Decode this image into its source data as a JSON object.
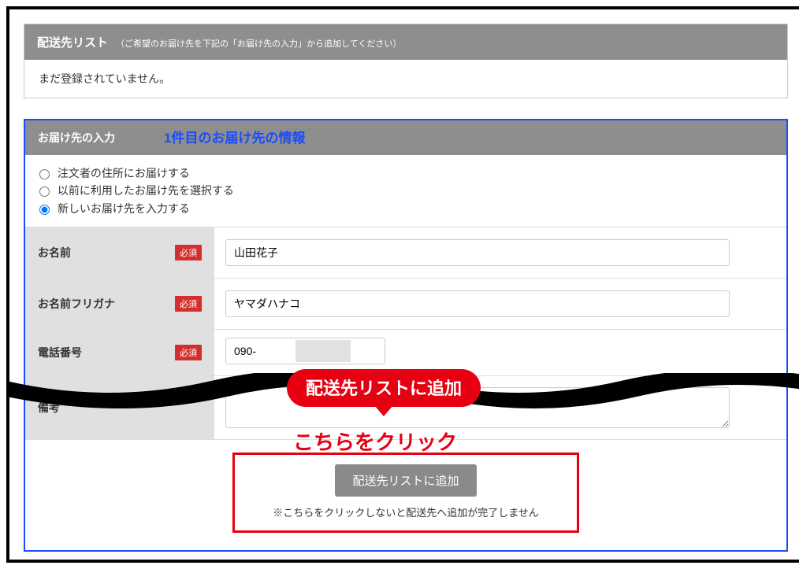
{
  "deliveryList": {
    "title": "配送先リスト",
    "subtitle": "（ご希望のお届け先を下記の「お届け先の入力」から追加してください）",
    "emptyMessage": "まだ登録されていません。"
  },
  "entry": {
    "title": "お届け先の入力",
    "annotation": "1件目のお届け先の情報",
    "radios": {
      "option1": "注文者の住所にお届けする",
      "option2": "以前に利用したお届け先を選択する",
      "option3": "新しいお届け先を入力する",
      "selected": 3
    },
    "fields": {
      "requiredLabel": "必須",
      "name": {
        "label": "お名前",
        "value": "山田花子"
      },
      "nameKana": {
        "label": "お名前フリガナ",
        "value": "ヤマダハナコ"
      },
      "phone": {
        "label": "電話番号",
        "value": "090-"
      },
      "note": {
        "label": "備考",
        "value": ""
      }
    }
  },
  "callout": {
    "bubble": "配送先リストに追加",
    "clickText": "こちらをクリック"
  },
  "submit": {
    "buttonLabel": "配送先リストに追加",
    "note": "※こちらをクリックしないと配送先へ追加が完了しません"
  }
}
